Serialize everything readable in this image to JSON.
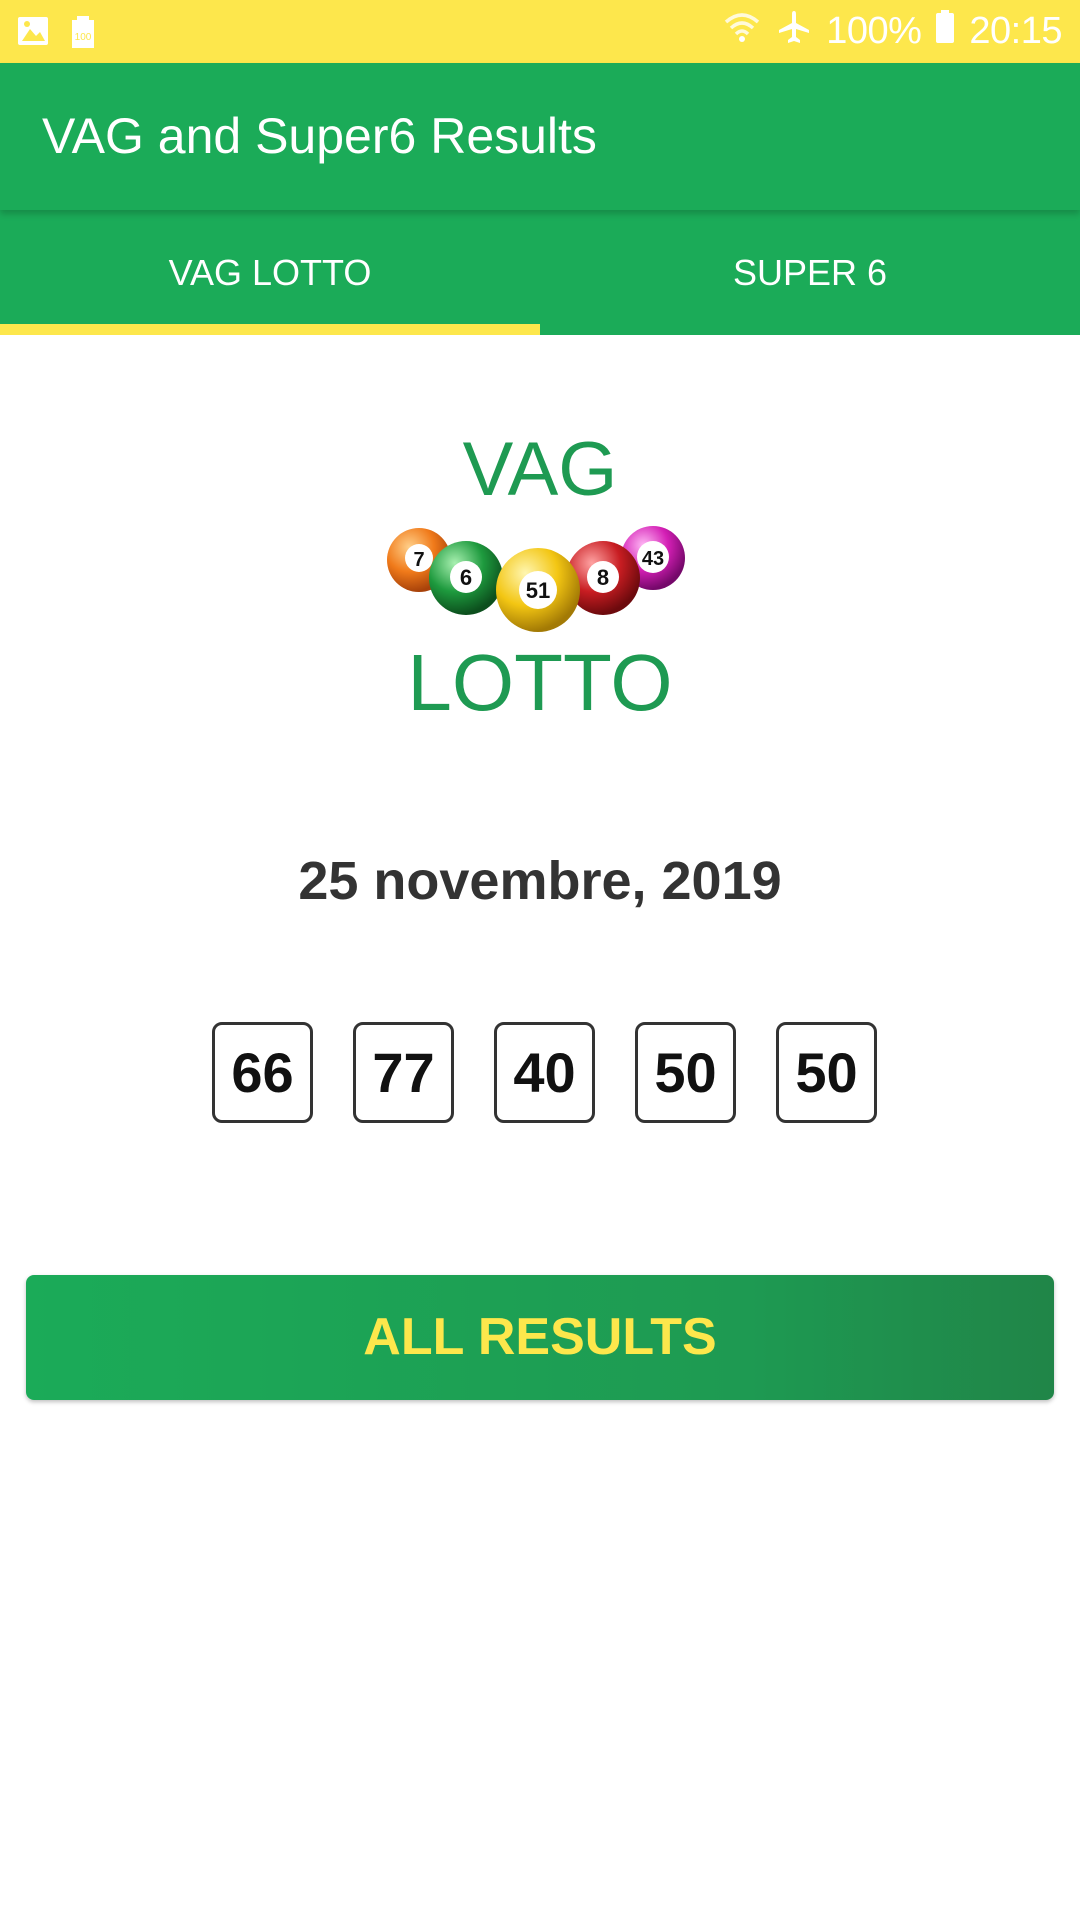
{
  "status_bar": {
    "battery": "100%",
    "time": "20:15",
    "storage_label": "100"
  },
  "app_bar": {
    "title": "VAG and Super6 Results"
  },
  "tabs": [
    {
      "label": "VAG LOTTO",
      "active": true
    },
    {
      "label": "SUPER 6",
      "active": false
    }
  ],
  "logo": {
    "top_text": "VAG",
    "bottom_text": "LOTTO",
    "balls": [
      "7",
      "6",
      "51",
      "8",
      "43"
    ]
  },
  "draw": {
    "date": "25 novembre, 2019",
    "numbers": [
      "66",
      "77",
      "40",
      "50",
      "50"
    ]
  },
  "all_results_label": "ALL RESULTS",
  "colors": {
    "primary_green": "#1bab58",
    "accent_yellow": "#fde74c"
  }
}
